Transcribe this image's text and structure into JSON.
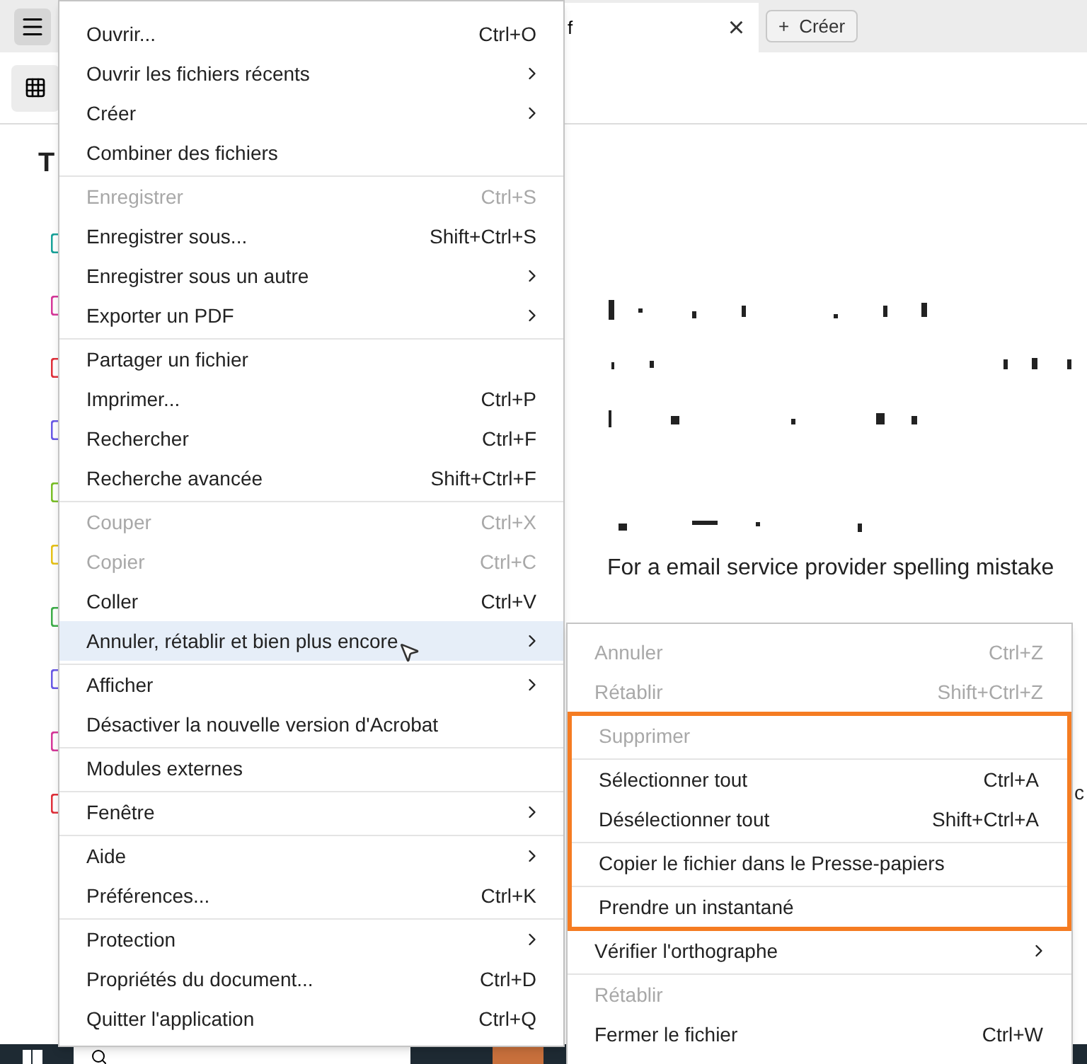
{
  "tab": {
    "title": "f",
    "close": "×"
  },
  "create_button": {
    "icon": "+",
    "label": "Créer"
  },
  "left_panel": {
    "heading": "T"
  },
  "document": {
    "line": "For a  email service provider spelling mistake",
    "edge_fragment": "c"
  },
  "menu": {
    "items": [
      {
        "label": "Ouvrir...",
        "shortcut": "Ctrl+O",
        "submenu": false,
        "disabled": false,
        "selected": false,
        "divider_above": false
      },
      {
        "label": "Ouvrir les fichiers récents",
        "submenu": true,
        "disabled": false,
        "selected": false,
        "divider_above": false
      },
      {
        "label": "Créer",
        "submenu": true,
        "disabled": false,
        "selected": false,
        "divider_above": false
      },
      {
        "label": "Combiner des fichiers",
        "submenu": false,
        "disabled": false,
        "selected": false,
        "divider_above": false
      },
      {
        "label": "Enregistrer",
        "shortcut": "Ctrl+S",
        "submenu": false,
        "disabled": true,
        "selected": false,
        "divider_above": true
      },
      {
        "label": "Enregistrer sous...",
        "shortcut": "Shift+Ctrl+S",
        "submenu": false,
        "disabled": false,
        "selected": false,
        "divider_above": false
      },
      {
        "label": "Enregistrer sous un autre",
        "submenu": true,
        "disabled": false,
        "selected": false,
        "divider_above": false
      },
      {
        "label": "Exporter un PDF",
        "submenu": true,
        "disabled": false,
        "selected": false,
        "divider_above": false
      },
      {
        "label": "Partager un fichier",
        "submenu": false,
        "disabled": false,
        "selected": false,
        "divider_above": true
      },
      {
        "label": "Imprimer...",
        "shortcut": "Ctrl+P",
        "submenu": false,
        "disabled": false,
        "selected": false,
        "divider_above": false
      },
      {
        "label": "Rechercher",
        "shortcut": "Ctrl+F",
        "submenu": false,
        "disabled": false,
        "selected": false,
        "divider_above": false
      },
      {
        "label": "Recherche avancée",
        "shortcut": "Shift+Ctrl+F",
        "submenu": false,
        "disabled": false,
        "selected": false,
        "divider_above": false
      },
      {
        "label": "Couper",
        "shortcut": "Ctrl+X",
        "submenu": false,
        "disabled": true,
        "selected": false,
        "divider_above": true
      },
      {
        "label": "Copier",
        "shortcut": "Ctrl+C",
        "submenu": false,
        "disabled": true,
        "selected": false,
        "divider_above": false
      },
      {
        "label": "Coller",
        "shortcut": "Ctrl+V",
        "submenu": false,
        "disabled": false,
        "selected": false,
        "divider_above": false
      },
      {
        "label": "Annuler, rétablir et bien plus encore",
        "submenu": true,
        "disabled": false,
        "selected": true,
        "divider_above": false
      },
      {
        "label": "Afficher",
        "submenu": true,
        "disabled": false,
        "selected": false,
        "divider_above": true
      },
      {
        "label": "Désactiver la nouvelle version d'Acrobat",
        "submenu": false,
        "disabled": false,
        "selected": false,
        "divider_above": false
      },
      {
        "label": "Modules externes",
        "submenu": false,
        "disabled": false,
        "selected": false,
        "divider_above": true
      },
      {
        "label": "Fenêtre",
        "submenu": true,
        "disabled": false,
        "selected": false,
        "divider_above": true
      },
      {
        "label": "Aide",
        "submenu": true,
        "disabled": false,
        "selected": false,
        "divider_above": true
      },
      {
        "label": "Préférences...",
        "shortcut": "Ctrl+K",
        "submenu": false,
        "disabled": false,
        "selected": false,
        "divider_above": false
      },
      {
        "label": "Protection",
        "submenu": true,
        "disabled": false,
        "selected": false,
        "divider_above": true
      },
      {
        "label": "Propriétés du document...",
        "shortcut": "Ctrl+D",
        "submenu": false,
        "disabled": false,
        "selected": false,
        "divider_above": false
      },
      {
        "label": "Quitter l'application",
        "shortcut": "Ctrl+Q",
        "submenu": false,
        "disabled": false,
        "selected": false,
        "divider_above": false
      }
    ]
  },
  "submenu": {
    "items": [
      {
        "label": "Annuler",
        "shortcut": "Ctrl+Z",
        "submenu": false,
        "disabled": true,
        "divider_above": false,
        "outlined": false
      },
      {
        "label": "Rétablir",
        "shortcut": "Shift+Ctrl+Z",
        "submenu": false,
        "disabled": true,
        "divider_above": false,
        "outlined": false
      },
      {
        "label": "Supprimer",
        "submenu": false,
        "disabled": true,
        "divider_above": false,
        "outlined": true
      },
      {
        "label": "Sélectionner tout",
        "shortcut": "Ctrl+A",
        "submenu": false,
        "disabled": false,
        "divider_above": true,
        "outlined": true
      },
      {
        "label": "Désélectionner tout",
        "shortcut": "Shift+Ctrl+A",
        "submenu": false,
        "disabled": false,
        "divider_above": false,
        "outlined": true
      },
      {
        "label": "Copier le fichier dans le Presse-papiers",
        "submenu": false,
        "disabled": false,
        "divider_above": true,
        "outlined": true
      },
      {
        "label": "Prendre un instantané",
        "submenu": false,
        "disabled": false,
        "divider_above": true,
        "outlined": true
      },
      {
        "label": "Vérifier l'orthographe",
        "submenu": true,
        "disabled": false,
        "divider_above": false,
        "outlined": false
      },
      {
        "label": "Rétablir",
        "submenu": false,
        "disabled": true,
        "divider_above": true,
        "outlined": false
      },
      {
        "label": "Fermer le fichier",
        "shortcut": "Ctrl+W",
        "submenu": false,
        "disabled": false,
        "divider_above": false,
        "outlined": false
      }
    ]
  }
}
